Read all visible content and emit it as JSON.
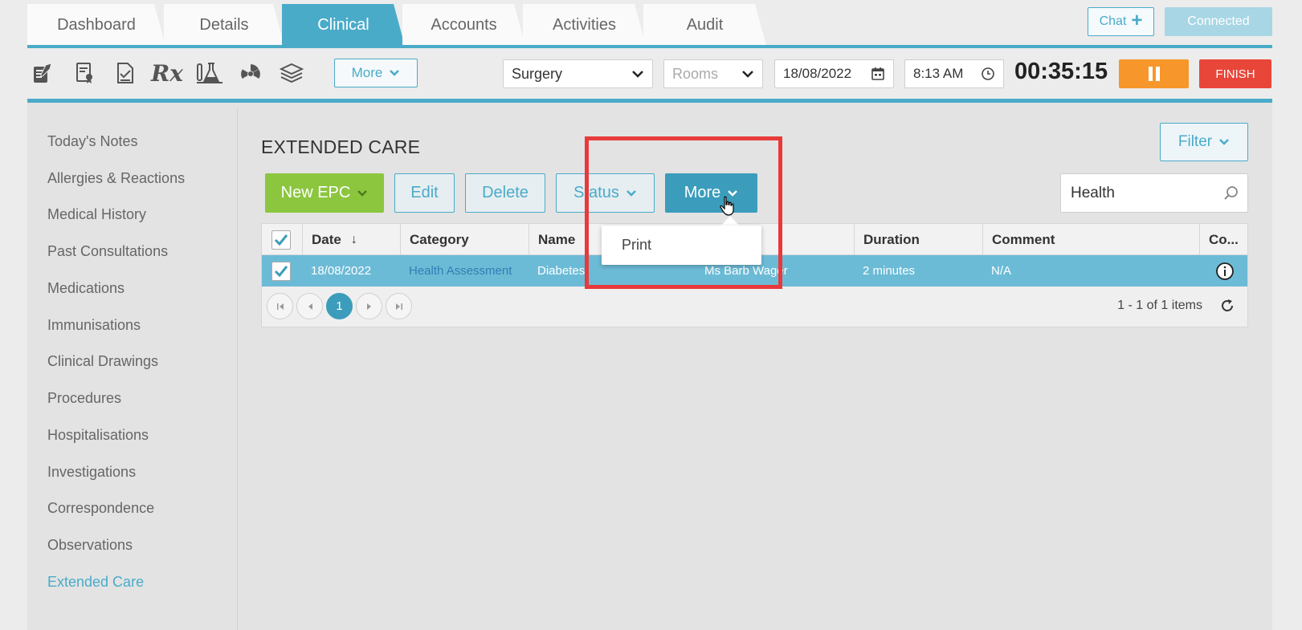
{
  "tabs": [
    {
      "label": "Dashboard",
      "active": false
    },
    {
      "label": "Details",
      "active": false
    },
    {
      "label": "Clinical",
      "active": true
    },
    {
      "label": "Accounts",
      "active": false
    },
    {
      "label": "Activities",
      "active": false
    },
    {
      "label": "Audit",
      "active": false
    }
  ],
  "header": {
    "chat_label": "Chat",
    "connected_label": "Connected"
  },
  "toolbar": {
    "icons": [
      "clinical-notes-icon",
      "certificate-icon",
      "document-icon",
      "prescription-icon",
      "lab-icon",
      "radiology-icon",
      "education-icon"
    ],
    "rx_glyph": "Rx",
    "more_label": "More",
    "location": "Surgery",
    "rooms_placeholder": "Rooms",
    "date": "18/08/2022",
    "time": "8:13 AM",
    "timer": "00:35:15",
    "finish_label": "FINISH"
  },
  "sidebar": {
    "items": [
      {
        "label": "Today's Notes",
        "active": false
      },
      {
        "label": "Allergies & Reactions",
        "active": false
      },
      {
        "label": "Medical History",
        "active": false
      },
      {
        "label": "Past Consultations",
        "active": false
      },
      {
        "label": "Medications",
        "active": false
      },
      {
        "label": "Immunisations",
        "active": false
      },
      {
        "label": "Clinical Drawings",
        "active": false
      },
      {
        "label": "Procedures",
        "active": false
      },
      {
        "label": "Hospitalisations",
        "active": false
      },
      {
        "label": "Investigations",
        "active": false
      },
      {
        "label": "Correspondence",
        "active": false
      },
      {
        "label": "Observations",
        "active": false
      },
      {
        "label": "Extended Care",
        "active": true
      }
    ]
  },
  "main": {
    "title": "EXTENDED CARE",
    "filter_label": "Filter",
    "actions": {
      "new_epc": "New EPC",
      "edit": "Edit",
      "delete": "Delete",
      "status": "Status",
      "more": "More"
    },
    "search_value": "Health",
    "grid": {
      "columns": [
        "Date",
        "Category",
        "Name",
        "Duration",
        "Comment",
        "Co..."
      ],
      "rows": [
        {
          "date": "18/08/2022",
          "category": "Health Assessment",
          "name": "Diabetes",
          "provider": "Ms Barb Wager",
          "duration": "2 minutes",
          "comment": "N/A",
          "checked": true
        }
      ],
      "current_page": "1",
      "pager_info": "1 - 1 of 1 items"
    },
    "more_menu": {
      "items": [
        "Print"
      ]
    }
  },
  "colors": {
    "accent": "#4aabc9",
    "green": "#8cc63f",
    "orange": "#f7962a",
    "red": "#e9463a",
    "selected_row": "#6cbbd6",
    "highlight": "#e8393b"
  }
}
